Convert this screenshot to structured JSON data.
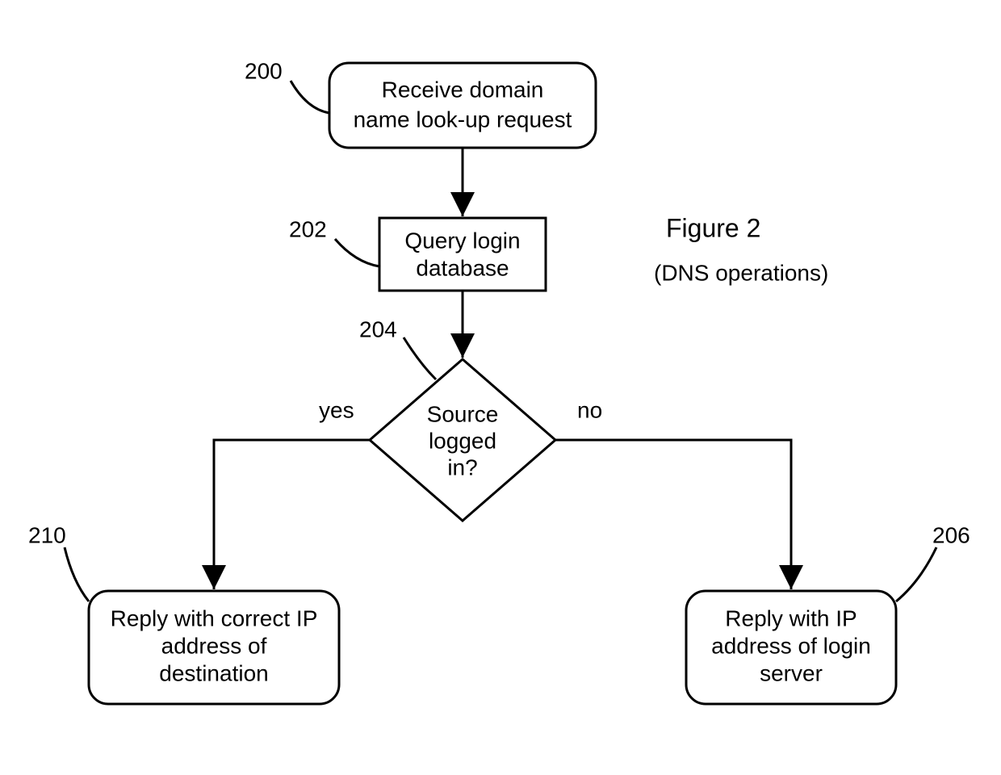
{
  "figure": {
    "title": "Figure 2",
    "subtitle": "(DNS operations)"
  },
  "nodes": {
    "n200": {
      "ref": "200",
      "line1": "Receive domain",
      "line2": "name look-up request"
    },
    "n202": {
      "ref": "202",
      "line1": "Query login",
      "line2": "database"
    },
    "n204": {
      "ref": "204",
      "line1": "Source",
      "line2": "logged",
      "line3": "in?"
    },
    "n210": {
      "ref": "210",
      "line1": "Reply with correct IP",
      "line2": "address of",
      "line3": "destination"
    },
    "n206": {
      "ref": "206",
      "line1": "Reply with IP",
      "line2": "address of login",
      "line3": "server"
    }
  },
  "branches": {
    "yes": "yes",
    "no": "no"
  }
}
